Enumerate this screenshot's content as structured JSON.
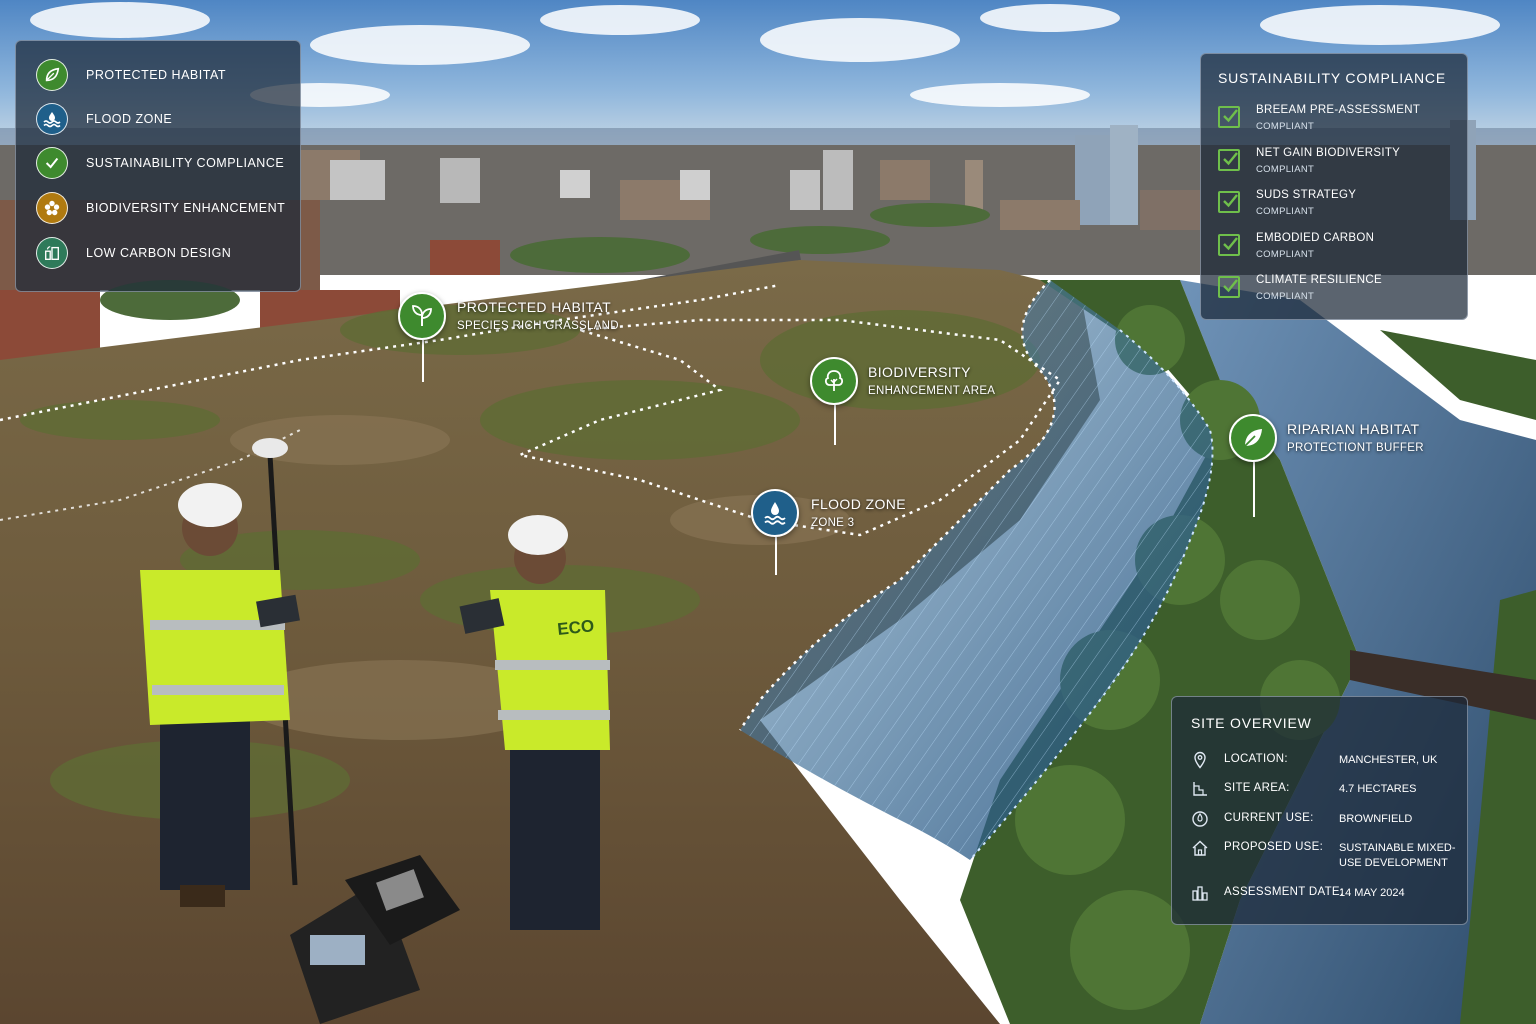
{
  "legend": {
    "items": [
      {
        "label": "PROTECTED HABITAT",
        "icon": "leaf-icon",
        "color": "#3e8a2e"
      },
      {
        "label": "FLOOD ZONE",
        "icon": "water-wave-icon",
        "color": "#1f5f8a"
      },
      {
        "label": "SUSTAINABILITY COMPLIANCE",
        "icon": "checkmark-icon",
        "color": "#3e8a2e"
      },
      {
        "label": "BIODIVERSITY ENHANCEMENT",
        "icon": "flower-icon",
        "color": "#b07a10"
      },
      {
        "label": "LOW CARBON DESIGN",
        "icon": "building-icon",
        "color": "#2e7a5a"
      }
    ]
  },
  "compliance": {
    "title": "SUSTAINABILITY COMPLIANCE",
    "items": [
      {
        "name": "BREEAM PRE-ASSESSMENT",
        "status": "COMPLIANT"
      },
      {
        "name": "NET GAIN BIODIVERSITY",
        "status": "COMPLIANT"
      },
      {
        "name": "SUDS STRATEGY",
        "status": "COMPLIANT"
      },
      {
        "name": "EMBODIED CARBON",
        "status": "COMPLIANT"
      },
      {
        "name": "CLIMATE RESILIENCE",
        "status": "COMPLIANT"
      }
    ]
  },
  "overview": {
    "title": "SITE OVERVIEW",
    "rows": [
      {
        "label": "LOCATION:",
        "value": "MANCHESTER, UK",
        "icon": "location-pin-icon"
      },
      {
        "label": "SITE AREA:",
        "value": "4.7 HECTARES",
        "icon": "area-icon"
      },
      {
        "label": "CURRENT USE:",
        "value": "BROWNFIELD",
        "icon": "target-icon"
      },
      {
        "label": "PROPOSED USE:",
        "value": "SUSTAINABLE MIXED-USE DEVELOPMENT",
        "icon": "home-icon"
      },
      {
        "label": "ASSESSMENT DATE:",
        "value": "14 MAY 2024",
        "icon": "city-icon"
      }
    ]
  },
  "markers": {
    "habitat": {
      "title": "PROTECTED HABITAT",
      "sub": "SPECIES RICH GRASSLAND"
    },
    "biodiversity": {
      "title": "BIODIVERSITY",
      "sub": "ENHANCEMENT AREA"
    },
    "flood": {
      "title": "FLOOD ZONE",
      "sub": "ZONE 3"
    },
    "riparian": {
      "title": "RIPARIAN HABITAT",
      "sub": "PROTECTIONT BUFFER"
    }
  },
  "vest_text": "ECO",
  "colors": {
    "accent_green": "#3e8a2e",
    "flood_blue": "#1f5f8a",
    "check_green": "#6fbf4b",
    "panel_bg": "#1c2838"
  }
}
